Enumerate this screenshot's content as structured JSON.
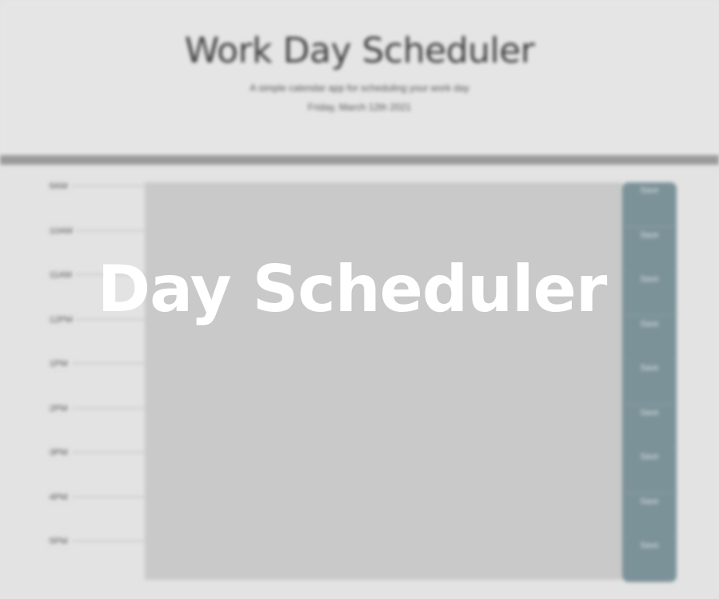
{
  "header": {
    "title": "Work Day Scheduler",
    "lead": "A simple calendar app for scheduling your work day",
    "current_day": "Friday, March 12th 2021"
  },
  "schedule": {
    "hours": [
      "9AM",
      "10AM",
      "11AM",
      "12PM",
      "1PM",
      "2PM",
      "3PM",
      "4PM",
      "5PM"
    ],
    "save_label": "Save"
  },
  "overlay": {
    "title": "Day Scheduler"
  },
  "colors": {
    "background": "#e3e3e3",
    "divider": "#9b9b9b",
    "textarea": "#c9c9c9",
    "save_button": "#7c9299",
    "overlay_text": "#ffffff"
  }
}
